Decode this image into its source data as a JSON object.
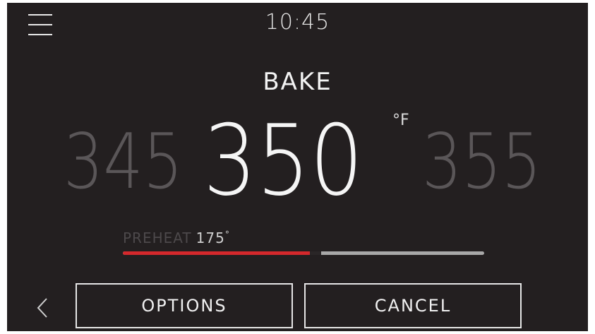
{
  "header": {
    "time": "10:45",
    "menu_icon": "hamburger-menu-icon"
  },
  "mode": {
    "label": "BAKE"
  },
  "temperature": {
    "previous": "345",
    "current": "350",
    "next": "355",
    "unit": "°F"
  },
  "preheat": {
    "label": "PREHEAT",
    "value": "175",
    "degree": "°",
    "progress_fraction": 0.53
  },
  "footer": {
    "back_icon": "chevron-left-icon",
    "options_label": "OPTIONS",
    "cancel_label": "CANCEL"
  },
  "colors": {
    "background": "#231f20",
    "progress_fill": "#d4282c",
    "progress_track": "#a8a8a8",
    "text_primary": "#f5f5f5",
    "text_dim": "#5a5658"
  }
}
